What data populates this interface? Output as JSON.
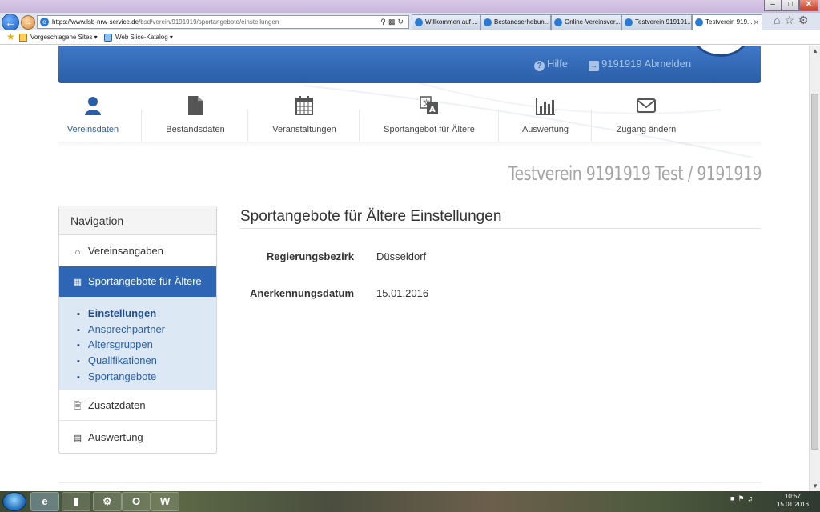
{
  "browser": {
    "url_host": "https://www.lsb-nrw-service.de",
    "url_path": "/bsd/verein/9191919/sportangebote/einstellungen",
    "tabs": [
      {
        "label": "Willkommen auf ..."
      },
      {
        "label": "Bestandserhebun..."
      },
      {
        "label": "Online-Vereinsver..."
      },
      {
        "label": "Testverein 919191..."
      },
      {
        "label": "Testverein 919..."
      }
    ],
    "favorites": {
      "suggested": "Vorgeschlagene Sites ▾",
      "webslice": "Web Slice-Katalog ▾"
    }
  },
  "header": {
    "help": "Hilfe",
    "logout": "9191919 Abmelden"
  },
  "top_menu": [
    {
      "label": "Vereinsdaten",
      "icon": "user-icon"
    },
    {
      "label": "Bestandsdaten",
      "icon": "document-icon"
    },
    {
      "label": "Veranstaltungen",
      "icon": "calendar-icon"
    },
    {
      "label": "Sportangebot für Ältere",
      "icon": "translate-icon"
    },
    {
      "label": "Auswertung",
      "icon": "bar-chart-icon"
    },
    {
      "label": "Zugang ändern",
      "icon": "envelope-icon"
    }
  ],
  "club_title": "Testverein 9191919 Test / 9191919",
  "sidebar": {
    "heading": "Navigation",
    "items": [
      {
        "label": "Vereinsangaben"
      },
      {
        "label": "Sportangebote für Ältere"
      },
      {
        "label": "Zusatzdaten"
      },
      {
        "label": "Auswertung"
      }
    ],
    "sub_items": [
      {
        "label": "Einstellungen"
      },
      {
        "label": "Ansprechpartner"
      },
      {
        "label": "Altersgruppen"
      },
      {
        "label": "Qualifikationen"
      },
      {
        "label": "Sportangebote"
      }
    ]
  },
  "content": {
    "title": "Sportangebote für Ältere Einstellungen",
    "fields": [
      {
        "label": "Regierungsbezirk",
        "value": "Düsseldorf"
      },
      {
        "label": "Anerkennungsdatum",
        "value": "15.01.2016"
      }
    ]
  },
  "taskbar": {
    "time": "10:57",
    "date": "15.01.2016"
  }
}
